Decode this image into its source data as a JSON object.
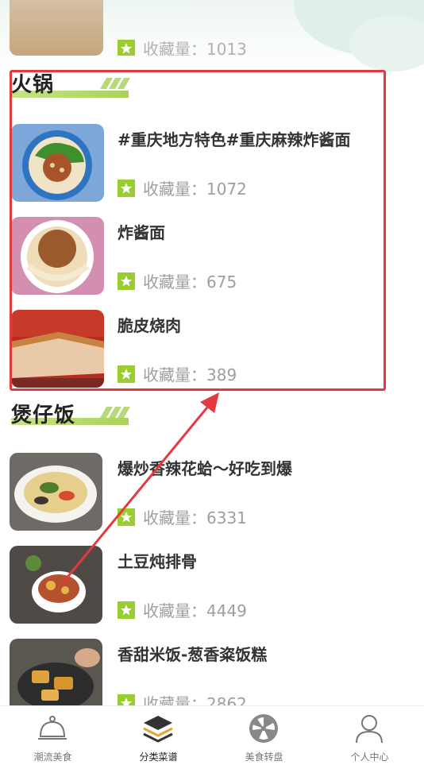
{
  "partial_item": {
    "fav_label": "收藏量：1013"
  },
  "sections": [
    {
      "title": "火锅",
      "items": [
        {
          "name": "#重庆地方特色#重庆麻辣炸酱面",
          "fav_label": "收藏量：1072"
        },
        {
          "name": "炸酱面",
          "fav_label": "收藏量：675"
        },
        {
          "name": "脆皮烧肉",
          "fav_label": "收藏量：389"
        }
      ]
    },
    {
      "title": "煲仔饭",
      "items": [
        {
          "name": "爆炒香辣花蛤～好吃到爆",
          "fav_label": "收藏量：6331"
        },
        {
          "name": "土豆炖排骨",
          "fav_label": "收藏量：4449"
        },
        {
          "name": "香甜米饭-葱香粢饭糕",
          "fav_label": "收藏量：2862"
        }
      ]
    }
  ],
  "tabbar": {
    "tabs": [
      {
        "label": "潮流美食",
        "icon": "cloche-icon"
      },
      {
        "label": "分类菜谱",
        "icon": "layers-icon",
        "active": true
      },
      {
        "label": "美食转盘",
        "icon": "wheel-icon"
      },
      {
        "label": "个人中心",
        "icon": "person-icon"
      }
    ]
  },
  "colors": {
    "accent_green": "#9acd32",
    "highlight_red": "#e53940"
  }
}
